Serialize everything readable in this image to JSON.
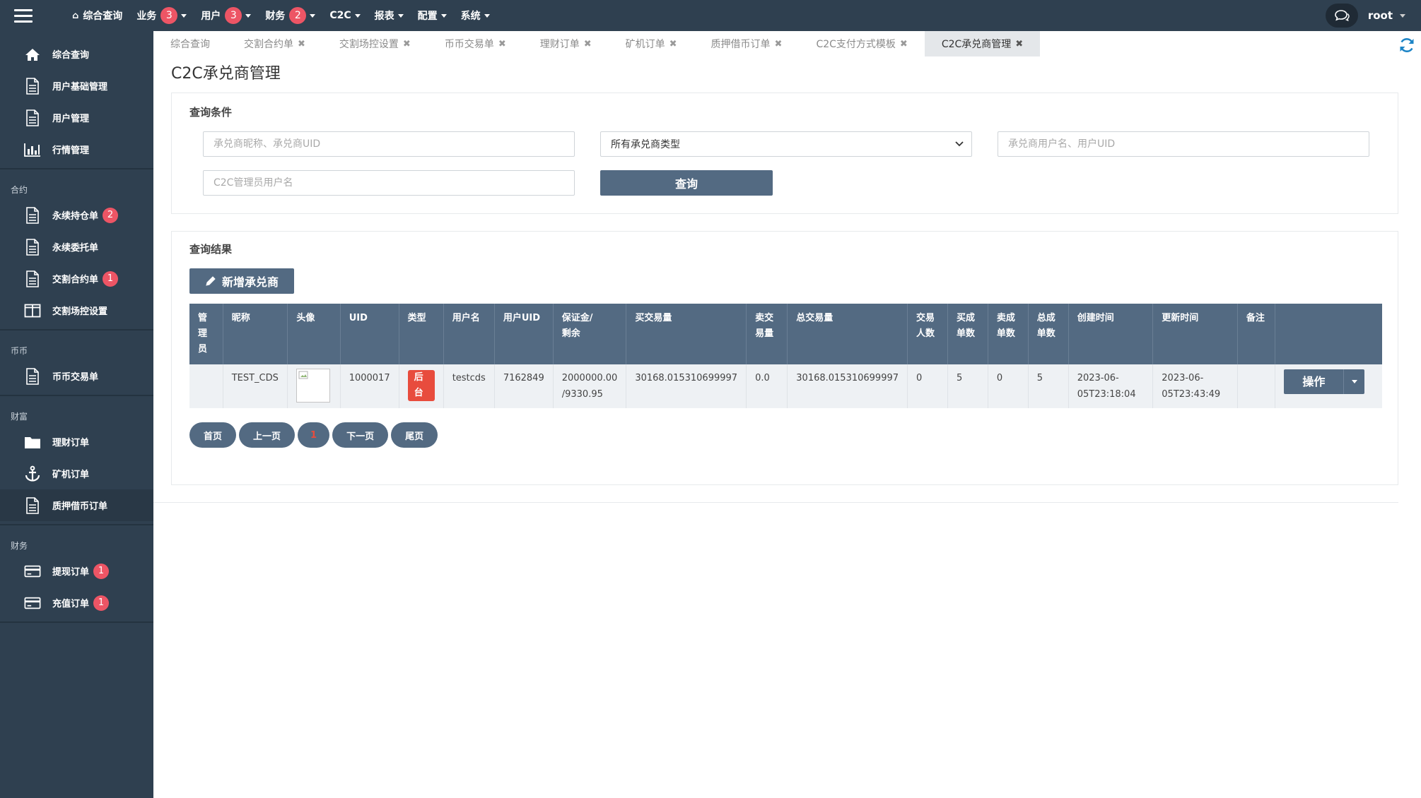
{
  "topbar": {
    "nav": [
      {
        "label": "综合查询",
        "has_home_icon": true
      },
      {
        "label": "业务",
        "badge": "3",
        "has_caret": true
      },
      {
        "label": "用户",
        "badge": "3",
        "has_caret": true
      },
      {
        "label": "财务",
        "badge": "2",
        "has_caret": true
      },
      {
        "label": "C2C",
        "has_caret": true
      },
      {
        "label": "报表",
        "has_caret": true
      },
      {
        "label": "配置",
        "has_caret": true
      },
      {
        "label": "系统",
        "has_caret": true
      }
    ],
    "user": "root"
  },
  "sidebar": {
    "groups": [
      {
        "title": "",
        "items": [
          {
            "label": "综合查询",
            "icon": "home-icon"
          },
          {
            "label": "用户基础管理",
            "icon": "file-icon"
          },
          {
            "label": "用户管理",
            "icon": "file-icon"
          },
          {
            "label": "行情管理",
            "icon": "bar-chart-icon"
          }
        ]
      },
      {
        "title": "合约",
        "items": [
          {
            "label": "永续持仓单",
            "icon": "file-icon",
            "badge": "2"
          },
          {
            "label": "永续委托单",
            "icon": "file-icon"
          },
          {
            "label": "交割合约单",
            "icon": "file-icon",
            "badge": "1"
          },
          {
            "label": "交割场控设置",
            "icon": "columns-icon"
          }
        ]
      },
      {
        "title": "币币",
        "items": [
          {
            "label": "币币交易单",
            "icon": "file-icon"
          }
        ]
      },
      {
        "title": "财富",
        "items": [
          {
            "label": "理财订单",
            "icon": "folder-icon"
          },
          {
            "label": "矿机订单",
            "icon": "anchor-icon"
          },
          {
            "label": "质押借币订单",
            "icon": "file-icon",
            "active": true
          }
        ]
      },
      {
        "title": "财务",
        "items": [
          {
            "label": "提现订单",
            "icon": "credit-card-icon",
            "badge": "1"
          },
          {
            "label": "充值订单",
            "icon": "credit-card-icon",
            "badge": "1"
          }
        ]
      }
    ]
  },
  "tabs": [
    {
      "label": "综合查询",
      "closable": false
    },
    {
      "label": "交割合约单",
      "closable": true
    },
    {
      "label": "交割场控设置",
      "closable": true
    },
    {
      "label": "币币交易单",
      "closable": true
    },
    {
      "label": "理财订单",
      "closable": true
    },
    {
      "label": "矿机订单",
      "closable": true
    },
    {
      "label": "质押借币订单",
      "closable": true
    },
    {
      "label": "C2C支付方式模板",
      "closable": true
    },
    {
      "label": "C2C承兑商管理",
      "closable": true,
      "active": true
    }
  ],
  "page": {
    "title": "C2C承兑商管理"
  },
  "query": {
    "title": "查询条件",
    "merchant_placeholder": "承兑商昵称、承兑商UID",
    "type_select_value": "所有承兑商类型",
    "username_placeholder": "承兑商用户名、用户UID",
    "admin_placeholder": "C2C管理员用户名",
    "submit_label": "查询"
  },
  "results": {
    "title": "查询结果",
    "add_label": "新增承兑商",
    "columns": [
      "管理员",
      "昵称",
      "头像",
      "UID",
      "类型",
      "用户名",
      "用户UID",
      "保证金/剩余",
      "买交易量",
      "卖交易量",
      "总交易量",
      "交易人数",
      "买成单数",
      "卖成单数",
      "总成单数",
      "创建时间",
      "更新时间",
      "备注",
      ""
    ],
    "rows": [
      {
        "admin": "",
        "nickname": "TEST_CDS",
        "uid": "1000017",
        "type": "后台",
        "username": "testcds",
        "user_uid": "7162849",
        "deposit": "2000000.00",
        "deposit_remaining": "/9330.95",
        "buy_volume": "30168.015310699997",
        "sell_volume": "0.0",
        "total_volume": "30168.015310699997",
        "traders": "0",
        "buy_orders": "5",
        "sell_orders": "0",
        "total_orders": "5",
        "created_date": "2023-06-",
        "created_time": "05T23:18:04",
        "updated_date": "2023-06-",
        "updated_time": "05T23:43:49",
        "remark": "",
        "op_label": "操作"
      }
    ]
  },
  "pager": {
    "first": "首页",
    "prev": "上一页",
    "current": "1",
    "next": "下一页",
    "last": "尾页"
  },
  "colors": {
    "sidebar_bg": "#2f4050",
    "primary": "#536a82",
    "badge": "#ed5565",
    "type_badge": "#e84c3d",
    "refresh": "#1c84c6"
  }
}
